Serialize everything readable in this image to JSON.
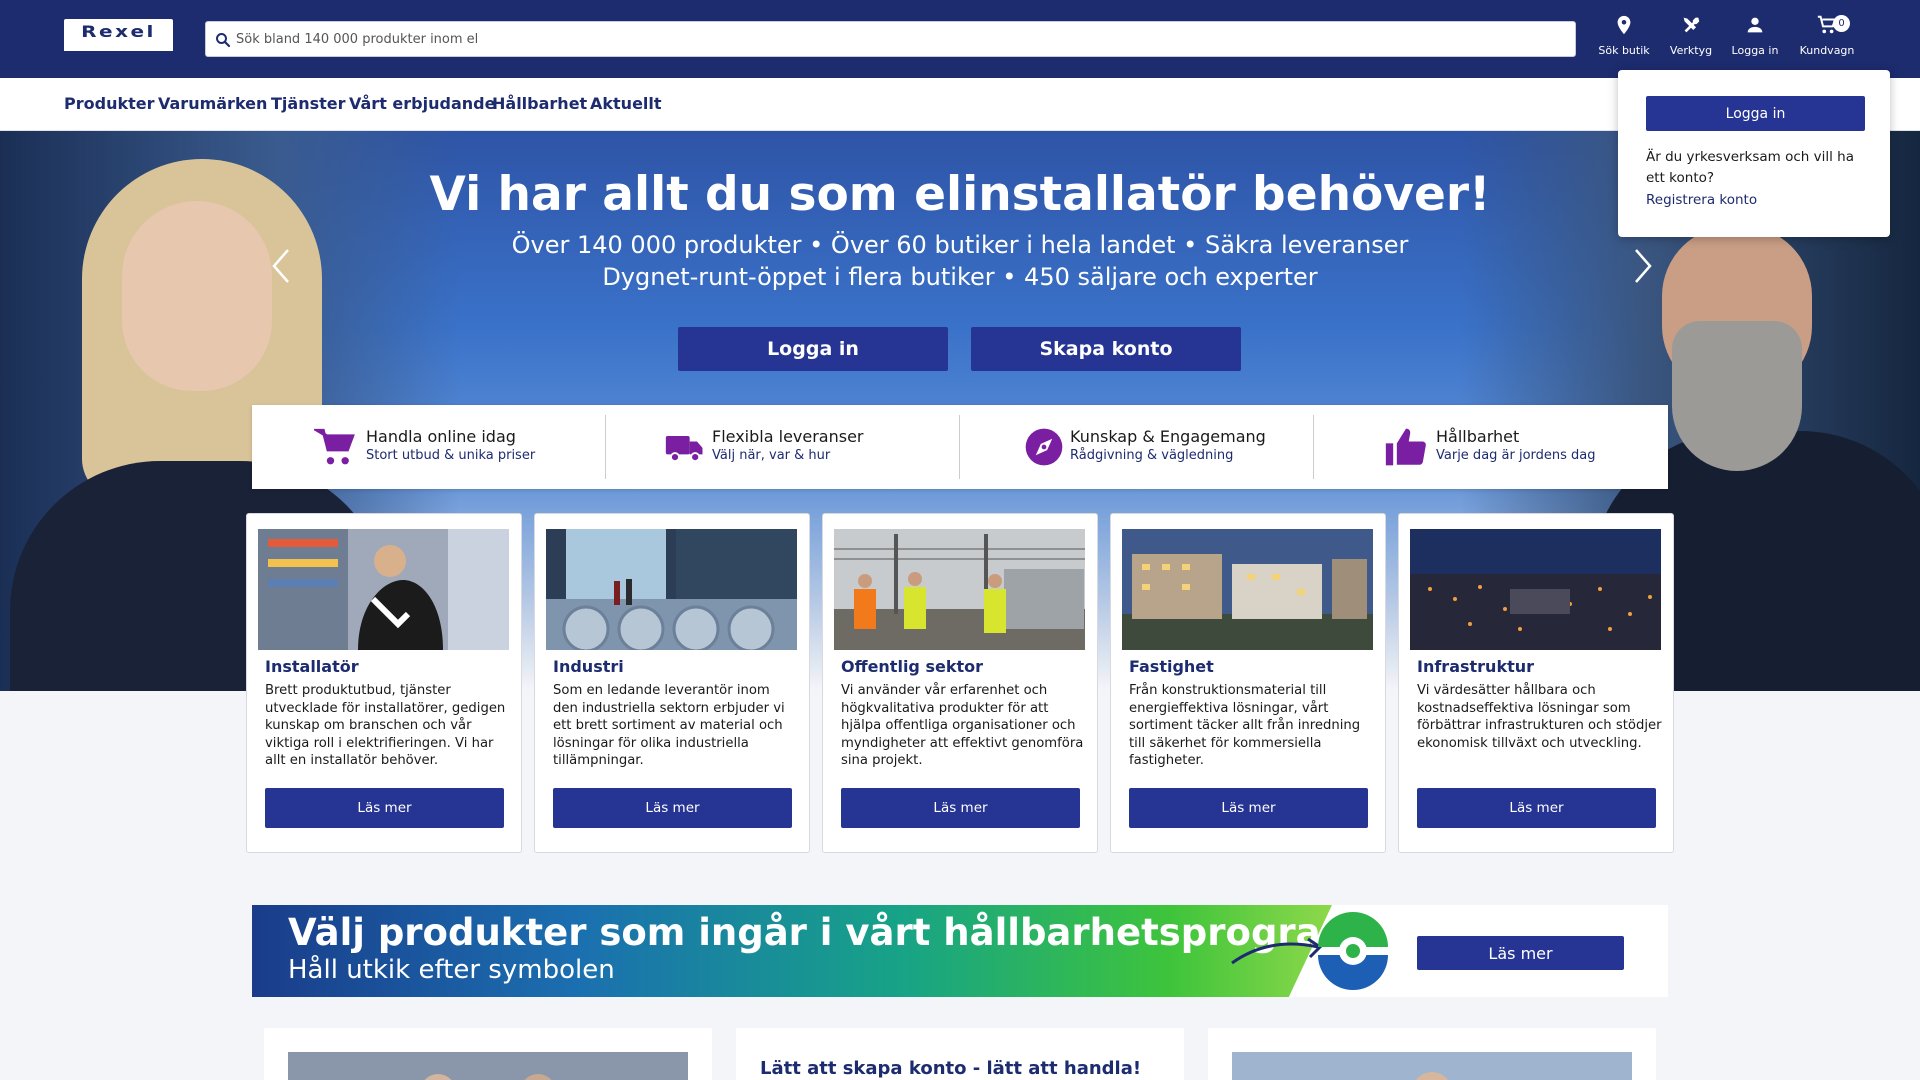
{
  "header": {
    "logo_text": "Rexel",
    "search_placeholder": "Sök bland 140 000 produkter inom el",
    "actions": {
      "store": {
        "label": "Sök butik",
        "icon": "location-pin-icon"
      },
      "tools": {
        "label": "Verktyg",
        "icon": "tools-icon"
      },
      "login": {
        "label": "Logga in",
        "icon": "user-icon"
      },
      "cart": {
        "label": "Kundvagn",
        "icon": "cart-icon",
        "count": "0"
      }
    }
  },
  "nav": {
    "items": [
      "Produkter",
      "Varumärken",
      "Tjänster",
      "Vårt erbjudande",
      "Hållbarhet",
      "Aktuellt"
    ]
  },
  "hero": {
    "title": "Vi har allt du som elinstallatör behöver!",
    "line1": "Över 140 000 produkter • Över 60 butiker i hela landet • Säkra leveranser",
    "line2": "Dygnet-runt-öppet i flera butiker • 450 säljare och experter",
    "login_button": "Logga in",
    "create_button": "Skapa konto"
  },
  "usps": [
    {
      "title": "Handla online idag",
      "subtitle": "Stort utbud & unika priser",
      "icon": "cart-icon"
    },
    {
      "title": "Flexibla leveranser",
      "subtitle": "Välj när, var & hur",
      "icon": "truck-icon"
    },
    {
      "title": "Kunskap & Engagemang",
      "subtitle": "Rådgivning & vägledning",
      "icon": "compass-icon"
    },
    {
      "title": "Hållbarhet",
      "subtitle": "Varje dag är jordens dag",
      "icon": "thumbs-up-icon"
    }
  ],
  "cards": [
    {
      "title": "Installatör",
      "text": "Brett produktutbud, tjänster utvecklade för installatörer, gedigen kunskap om branschen och vår viktiga roll i elektrifieringen. Vi har allt en installatör behöver.",
      "button": "Läs mer"
    },
    {
      "title": "Industri",
      "text": "Som en ledande leverantör inom den industriella sektorn erbjuder vi ett brett sortiment av material och lösningar för olika industriella tillämpningar.",
      "button": "Läs mer"
    },
    {
      "title": "Offentlig sektor",
      "text": "Vi använder vår erfarenhet och högkvalitativa produkter för att hjälpa offentliga organisationer och myndigheter att effektivt genomföra sina projekt.",
      "button": "Läs mer"
    },
    {
      "title": "Fastighet",
      "text": "Från konstruktionsmaterial till energieffektiva lösningar, vårt sortiment täcker allt från inredning till säkerhet för kommersiella fastigheter.",
      "button": "Läs mer"
    },
    {
      "title": "Infrastruktur",
      "text": "Vi värdesätter hållbara och kostnadseffektiva lösningar som förbättrar infrastrukturen och stödjer ekonomisk tillväxt och utveckling.",
      "button": "Läs mer"
    }
  ],
  "banner": {
    "title": "Välj produkter som ingår i vårt hållbarhetsprogram",
    "subtitle": "Håll utkik efter symbolen",
    "button": "Läs mer"
  },
  "teasers": {
    "middle_title": "Lätt att skapa konto - lätt att handla!"
  },
  "login_dropdown": {
    "button": "Logga in",
    "question": "Är du yrkesverksam och vill ha ett konto?",
    "register_link": "Registrera konto"
  },
  "colors": {
    "brand_navy": "#1d2b6f",
    "button_blue": "#263593",
    "accent_purple": "#7b1fa2"
  }
}
